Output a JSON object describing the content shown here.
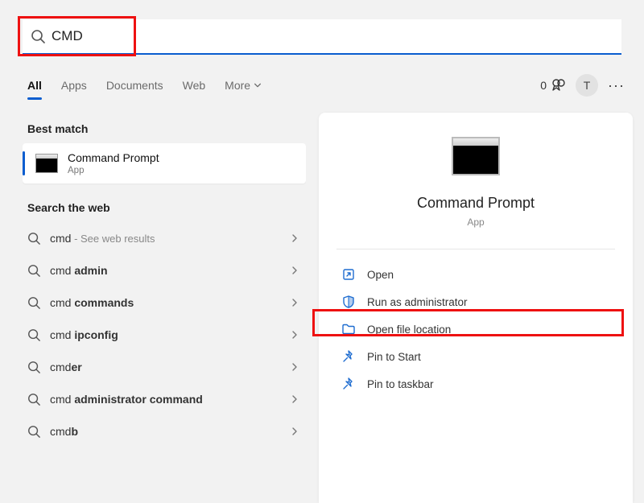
{
  "search": {
    "value": "CMD"
  },
  "tabs": {
    "all": "All",
    "apps": "Apps",
    "documents": "Documents",
    "web": "Web",
    "more": "More"
  },
  "rewards": {
    "count": "0"
  },
  "avatar_initial": "T",
  "left": {
    "best_match_heading": "Best match",
    "best_match": {
      "title": "Command Prompt",
      "subtitle": "App"
    },
    "web_heading": "Search the web",
    "web_items": [
      {
        "prefix": "cmd",
        "bold": "",
        "suffix": " - See web results",
        "see_style": true
      },
      {
        "prefix": "cmd ",
        "bold": "admin",
        "suffix": ""
      },
      {
        "prefix": "cmd ",
        "bold": "commands",
        "suffix": ""
      },
      {
        "prefix": "cmd ",
        "bold": "ipconfig",
        "suffix": ""
      },
      {
        "prefix": "cmd",
        "bold": "er",
        "suffix": ""
      },
      {
        "prefix": "cmd ",
        "bold": "administrator command",
        "suffix": ""
      },
      {
        "prefix": "cmd",
        "bold": "b",
        "suffix": ""
      }
    ]
  },
  "right": {
    "title": "Command Prompt",
    "subtitle": "App",
    "actions": [
      {
        "icon": "open-icon",
        "label": "Open"
      },
      {
        "icon": "shield-icon",
        "label": "Run as administrator"
      },
      {
        "icon": "folder-icon",
        "label": "Open file location"
      },
      {
        "icon": "pin-icon",
        "label": "Pin to Start"
      },
      {
        "icon": "pin-icon",
        "label": "Pin to taskbar"
      }
    ]
  }
}
